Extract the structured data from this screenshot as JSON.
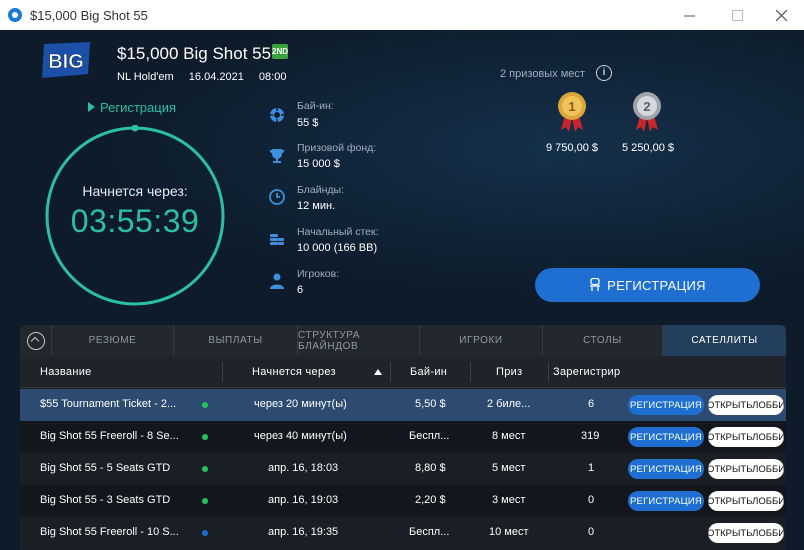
{
  "window": {
    "title": "$15,000 Big Shot 55"
  },
  "header": {
    "logo_text": "BIG",
    "title": "$15,000 Big Shot 55",
    "badge": "2ND",
    "game": "NL Hold'em",
    "date": "16.04.2021",
    "time": "08:00"
  },
  "registration": {
    "status": "Регистрация",
    "starts_label": "Начнется через:",
    "countdown": "03:55:39",
    "button_label": "РЕГИСТРАЦИЯ"
  },
  "info": [
    {
      "label": "Бай-ин:",
      "value": "55 $",
      "icon": "chip-icon"
    },
    {
      "label": "Призовой фонд:",
      "value": "15 000 $",
      "icon": "trophy-icon"
    },
    {
      "label": "Блайнды:",
      "value": "12 мин.",
      "icon": "clock-icon"
    },
    {
      "label": "Начальный стек:",
      "value": "10 000 (166 BB)",
      "icon": "chips-stack-icon"
    },
    {
      "label": "Игроков:",
      "value": "6",
      "icon": "user-icon"
    }
  ],
  "prizes": {
    "places_label": "2 призовых мест",
    "items": [
      {
        "place": "1",
        "amount": "9 750,00 $",
        "color": "#d9a53a"
      },
      {
        "place": "2",
        "amount": "5 250,00 $",
        "color": "#b9bec4"
      }
    ]
  },
  "tabs": [
    "РЕЗЮМЕ",
    "ВЫПЛАТЫ",
    "СТРУКТУРА БЛАЙНДОВ",
    "ИГРОКИ",
    "СТОЛЫ",
    "САТЕЛЛИТЫ"
  ],
  "table": {
    "headers": [
      "Название",
      "Начнется через",
      "Бай-ин",
      "Приз",
      "Зарегистрир"
    ],
    "reg_label": "РЕГИСТРАЦИЯ",
    "open_label": "ОТКРЫТЬЛОББИ",
    "rows": [
      {
        "name": "$55 Tournament Ticket - 2...",
        "dot": "#22c55e",
        "starts": "через 20 минут(ы)",
        "buyin": "5,50 $",
        "prize": "2 биле...",
        "registered": "6",
        "can_register": true
      },
      {
        "name": "Big Shot 55 Freeroll - 8 Se...",
        "dot": "#22c55e",
        "starts": "через 40 минут(ы)",
        "buyin": "Беспл...",
        "prize": "8 мест",
        "registered": "319",
        "can_register": true
      },
      {
        "name": "Big Shot 55 - 5 Seats GTD",
        "dot": "#22c55e",
        "starts": "апр. 16, 18:03",
        "buyin": "8,80 $",
        "prize": "5 мест",
        "registered": "1",
        "can_register": true
      },
      {
        "name": "Big Shot 55 - 3 Seats GTD",
        "dot": "#22c55e",
        "starts": "апр. 16, 19:03",
        "buyin": "2,20 $",
        "prize": "3 мест",
        "registered": "0",
        "can_register": true
      },
      {
        "name": "Big Shot 55 Freeroll - 10 S...",
        "dot": "#1e6fd1",
        "starts": "апр. 16, 19:35",
        "buyin": "Беспл...",
        "prize": "10 мест",
        "registered": "0",
        "can_register": false
      }
    ]
  }
}
